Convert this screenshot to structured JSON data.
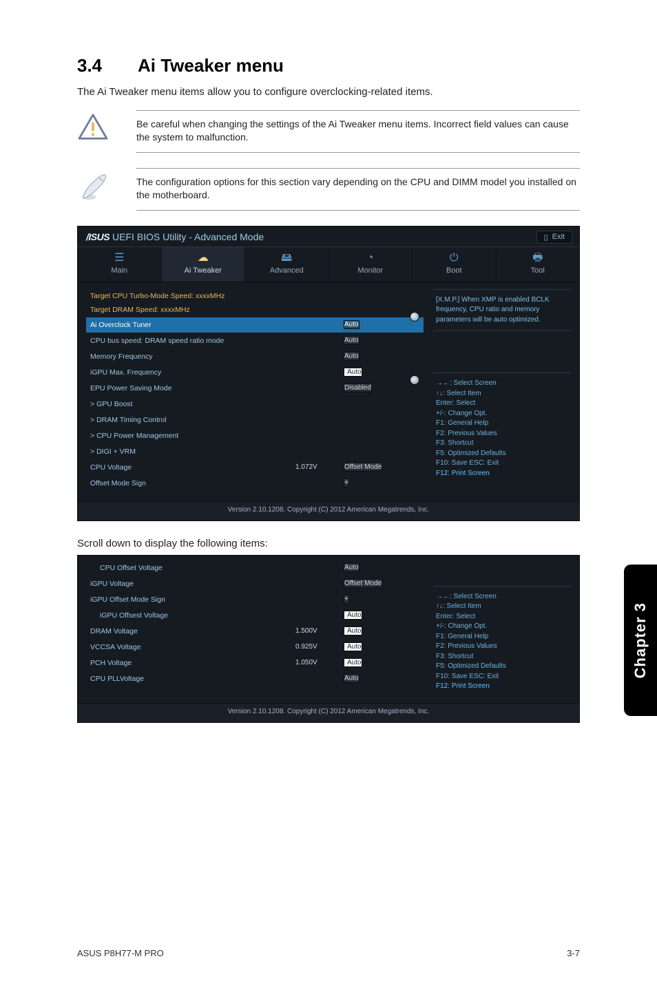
{
  "page": {
    "section_number": "3.4",
    "section_title": "Ai Tweaker menu",
    "intro": "The Ai Tweaker menu items allow you to configure overclocking-related items.",
    "warn": "Be careful when changing the settings of the Ai Tweaker menu items. Incorrect field values can cause the system to malfunction.",
    "note": "The configuration options for this section vary depending on the CPU and DIMM model you installed on the motherboard.",
    "scroll_hint": "Scroll down to display the following items:",
    "footer_model": "ASUS P8H77-M PRO",
    "footer_page": "3-7",
    "side_tab": "Chapter 3"
  },
  "bios": {
    "brand": "/ISUS",
    "title": "UEFI BIOS Utility - Advanced Mode",
    "exit": "Exit",
    "tabs": {
      "main": "Main",
      "ai_tweaker": "Ai  Tweaker",
      "advanced": "Advanced",
      "monitor": "Monitor",
      "boot": "Boot",
      "tool": "Tool"
    },
    "help_text": "[X.M.P.] When XMP is enabled BCLK frequency, CPU ratio and memory parameters will be auto optimized.",
    "keys": {
      "k1": "→←: Select Screen",
      "k2": "↑↓: Select Item",
      "k3": "Enter: Select",
      "k4": "+/-: Change Opt.",
      "k5": "F1: General Help",
      "k6": "F2: Previous Values",
      "k7": "F3: Shortcut",
      "k8": "F5: Optimized Defaults",
      "k9": "F10: Save   ESC: Exit",
      "k10": "F12: Print Screen"
    },
    "footer": "Version  2.10.1208.   Copyright  (C)  2012  American  Megatrends,  Inc."
  },
  "upper": {
    "target_cpu": "Target CPU Turbo-Mode Speed: xxxxMHz",
    "target_dram": "Target DRAM Speed:  xxxxMHz",
    "rows": {
      "ai_overclock": {
        "label": "Ai Overclock Tuner",
        "value": "Auto"
      },
      "cpu_bus": {
        "label": "CPU bus speed: DRAM speed ratio mode",
        "value": "Auto"
      },
      "mem_freq": {
        "label": "Memory Frequency",
        "value": "Auto"
      },
      "igpu_max": {
        "label": "iGPU Max. Frequency",
        "value": "Auto"
      },
      "epu": {
        "label": "EPU Power Saving Mode",
        "value": "Disabled"
      },
      "gpu_boost": {
        "label": "GPU Boost"
      },
      "dram_timing": {
        "label": "DRAM Timing Control"
      },
      "cpu_pm": {
        "label": "CPU Power Management"
      },
      "digi": {
        "label": "DIGI + VRM"
      },
      "cpu_voltage": {
        "label": "CPU Voltage",
        "mid": "1.072V",
        "value": "Offset Mode"
      },
      "offset_sign": {
        "label": "Offset Mode Sign",
        "value": "+"
      }
    }
  },
  "lower": {
    "rows": {
      "cpu_offset_v": {
        "label": "CPU Offset Voltage",
        "value": "Auto"
      },
      "igpu_v": {
        "label": "iGPU Voltage",
        "value": "Offset Mode"
      },
      "igpu_sign": {
        "label": "iGPU Offset Mode Sign",
        "value": "+"
      },
      "igpu_offset_v": {
        "label": "iGPU Offsest Voltage",
        "value": "Auto"
      },
      "dram_v": {
        "label": "DRAM Voltage",
        "mid": "1.500V",
        "value": "Auto"
      },
      "vccsa": {
        "label": "VCCSA Voltage",
        "mid": "0.925V",
        "value": "Auto"
      },
      "pch": {
        "label": "PCH Voltage",
        "mid": "1.050V",
        "value": "Auto"
      },
      "cpu_pll": {
        "label": "CPU PLLVoltage",
        "value": "Auto"
      }
    }
  }
}
